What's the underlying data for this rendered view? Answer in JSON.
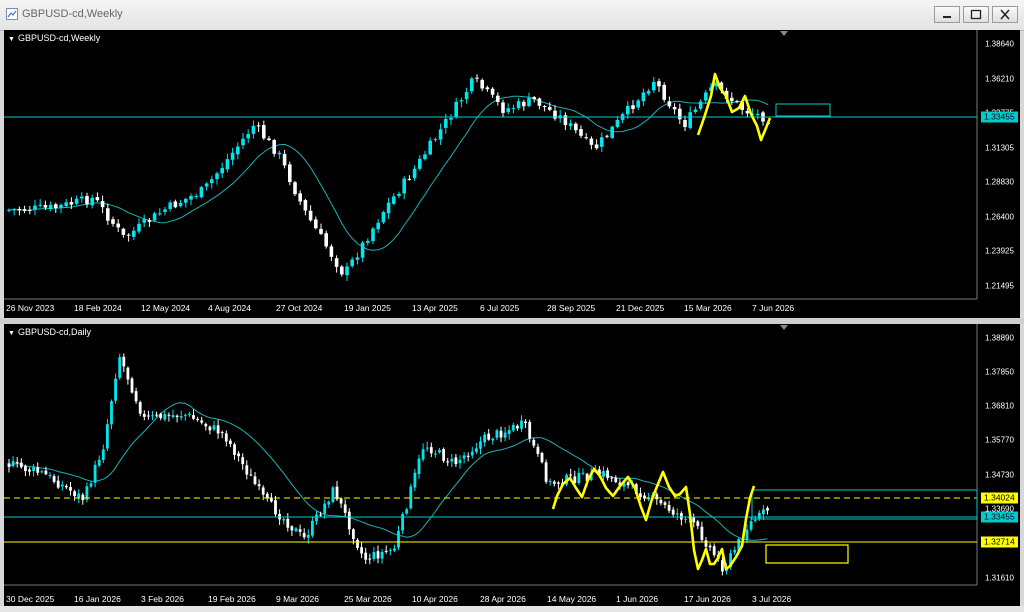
{
  "window": {
    "title": "GBPUSD-cd,Weekly"
  },
  "weekly": {
    "label": "GBPUSD-cd,Weekly",
    "y_ticks": [
      "1.38640",
      "1.36210",
      "1.33775",
      "1.31305",
      "1.28830",
      "1.26400",
      "1.23925",
      "1.21495"
    ],
    "x_ticks": [
      "26 Nov 2023",
      "18 Feb 2024",
      "12 May 2024",
      "4 Aug 2024",
      "27 Oct 2024",
      "19 Jan 2025",
      "13 Apr 2025",
      "6 Jul 2025",
      "28 Sep 2025",
      "21 Dec 2025",
      "15 Mar 2026",
      "7 Jun 2026"
    ],
    "current_price": "1.33455"
  },
  "daily": {
    "label": "GBPUSD-cd,Daily",
    "y_ticks": [
      "1.38890",
      "1.37850",
      "1.36810",
      "1.35770",
      "1.34730",
      "1.33690",
      "1.31610"
    ],
    "x_ticks": [
      "30 Dec 2025",
      "16 Jan 2026",
      "3 Feb 2026",
      "19 Feb 2026",
      "9 Mar 2026",
      "25 Mar 2026",
      "10 Apr 2026",
      "28 Apr 2026",
      "14 May 2026",
      "1 Jun 2026",
      "17 Jun 2026",
      "3 Jul 2026"
    ],
    "level_1": "1.34024",
    "current_price": "1.33455",
    "level_2": "1.32714"
  },
  "colors": {
    "bull": "#00e5ee",
    "bear": "#ffffff",
    "ma": "#19b3b3",
    "annotation": "#ffff00",
    "price_line": "#00cccc",
    "background": "#000000"
  },
  "icons": [
    "chart-window-icon",
    "minimize-icon",
    "restore-icon",
    "close-icon"
  ]
}
